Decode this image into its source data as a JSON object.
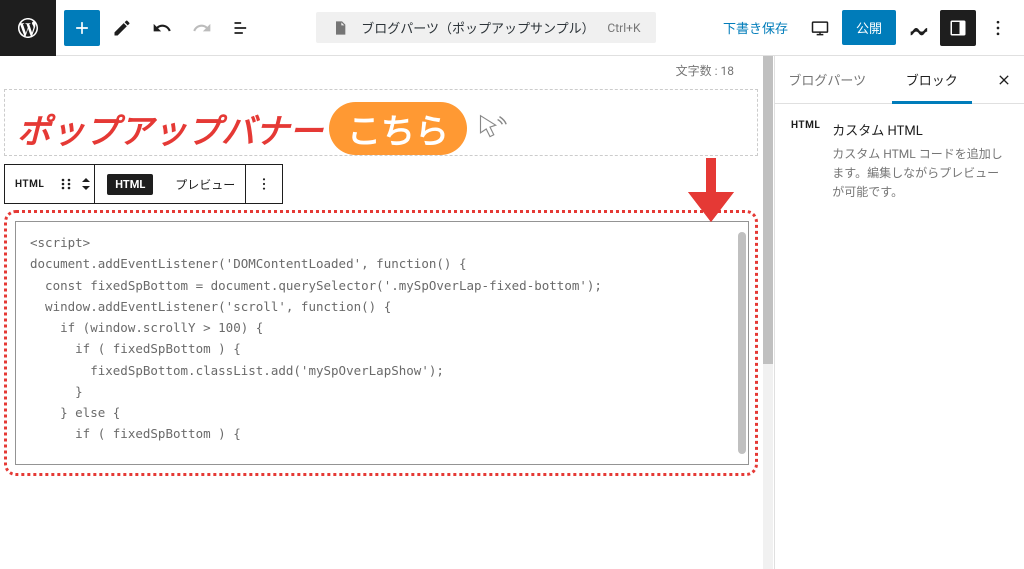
{
  "toolbar": {
    "doc_title": "ブログパーツ（ポップアップサンプル）",
    "keyboard_hint": "Ctrl+K",
    "save_draft": "下書き保存",
    "publish": "公開"
  },
  "char_count": "文字数 : 18",
  "banner": {
    "text_red": "ポップアップバナー",
    "text_pill": "こちら"
  },
  "block_toolbar": {
    "html_label": "HTML",
    "html_tab": "HTML",
    "preview_tab": "プレビュー"
  },
  "code": "<script>\ndocument.addEventListener('DOMContentLoaded', function() {\n  const fixedSpBottom = document.querySelector('.mySpOverLap-fixed-bottom');\n  window.addEventListener('scroll', function() {\n    if (window.scrollY > 100) {\n      if ( fixedSpBottom ) {\n        fixedSpBottom.classList.add('mySpOverLapShow');\n      }\n    } else {\n      if ( fixedSpBottom ) {",
  "sidebar": {
    "tab_blogparts": "ブログパーツ",
    "tab_block": "ブロック",
    "block_icon": "HTML",
    "block_title": "カスタム HTML",
    "block_desc": "カスタム HTML コードを追加します。編集しながらプレビューが可能です。"
  }
}
